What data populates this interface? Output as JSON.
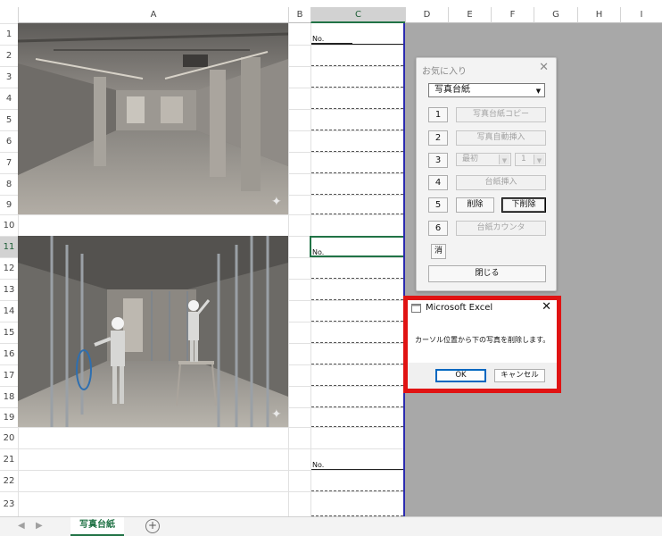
{
  "columns": [
    "A",
    "B",
    "C",
    "D",
    "E",
    "F",
    "G",
    "H",
    "I"
  ],
  "rows": [
    "1",
    "2",
    "3",
    "4",
    "5",
    "6",
    "7",
    "8",
    "9",
    "10",
    "11",
    "12",
    "13",
    "14",
    "15",
    "16",
    "17",
    "18",
    "19",
    "20",
    "21",
    "22",
    "23"
  ],
  "cells": {
    "c1_label": "No.",
    "c11_label": "No.",
    "c21_label": "No."
  },
  "photos": {
    "photo1_icon": "sparkle-watermark-icon",
    "photo2_icon": "sparkle-watermark-icon"
  },
  "favorites_panel": {
    "title": "お気に入り",
    "close": "✕",
    "dropdown_value": "写真台紙",
    "buttons": {
      "b1_num": "1",
      "b1_label": "写真台紙コピー",
      "b2_num": "2",
      "b2_label": "写真自動挿入",
      "b3_num": "3",
      "b3_combo1": "最初",
      "b3_combo2": "1",
      "b4_num": "4",
      "b4_label": "台紙挿入",
      "b5_num": "5",
      "b5_delete": "削除",
      "b5_delete_below": "下削除",
      "b6_num": "6",
      "b6_label": "台紙カウンタ",
      "clear": "消",
      "close_button": "閉じる"
    }
  },
  "dialog": {
    "title": "Microsoft Excel",
    "close": "✕",
    "message": "カーソル位置から下の写真を削除します。",
    "ok": "OK",
    "cancel": "キャンセル",
    "highlight_color": "#e01313"
  },
  "sheet_tabs": {
    "active_tab": "写真台紙",
    "add": "+",
    "prev": "◀",
    "next": "▶"
  },
  "colors": {
    "excel_green": "#217346",
    "print_boundary": "#2b2bb0",
    "gray_area": "#a8a8a8"
  }
}
